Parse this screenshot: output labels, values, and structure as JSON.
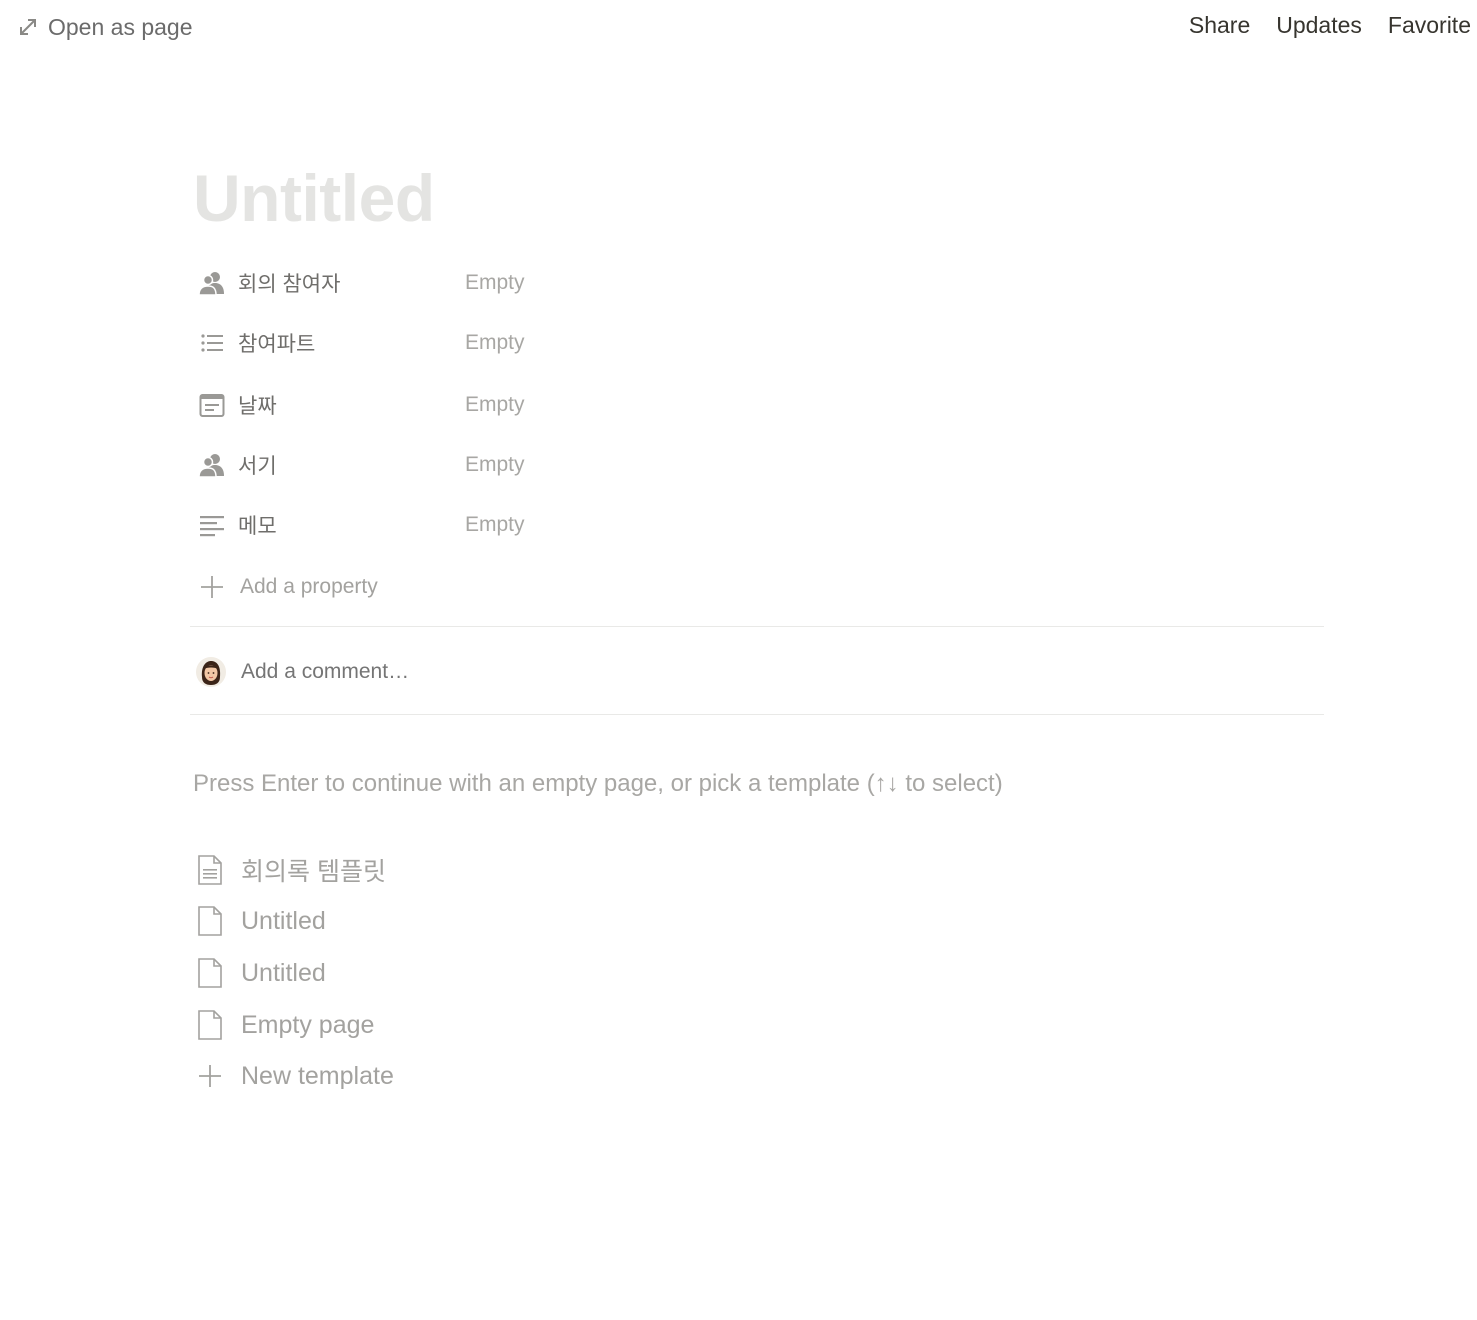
{
  "topbar": {
    "open_as_page": "Open as page",
    "actions": [
      "Share",
      "Updates",
      "Favorite"
    ]
  },
  "page": {
    "title": "Untitled"
  },
  "properties": [
    {
      "name": "회의 참여자",
      "value": "Empty",
      "icon": "people-icon"
    },
    {
      "name": "참여파트",
      "value": "Empty",
      "icon": "multi-select-icon"
    },
    {
      "name": "날짜",
      "value": "Empty",
      "icon": "calendar-icon"
    },
    {
      "name": "서기",
      "value": "Empty",
      "icon": "people-icon"
    },
    {
      "name": "메모",
      "value": "Empty",
      "icon": "text-icon"
    }
  ],
  "add_property": "Add a property",
  "comment": {
    "placeholder": "Add a comment…"
  },
  "hint": "Press Enter to continue with an empty page, or pick a template (↑↓ to select)",
  "templates": [
    {
      "label": "회의록 템플릿",
      "icon": "document-lines-icon"
    },
    {
      "label": "Untitled",
      "icon": "page-icon"
    },
    {
      "label": "Untitled",
      "icon": "page-icon"
    },
    {
      "label": "Empty page",
      "icon": "page-icon"
    }
  ],
  "new_template": "New template"
}
